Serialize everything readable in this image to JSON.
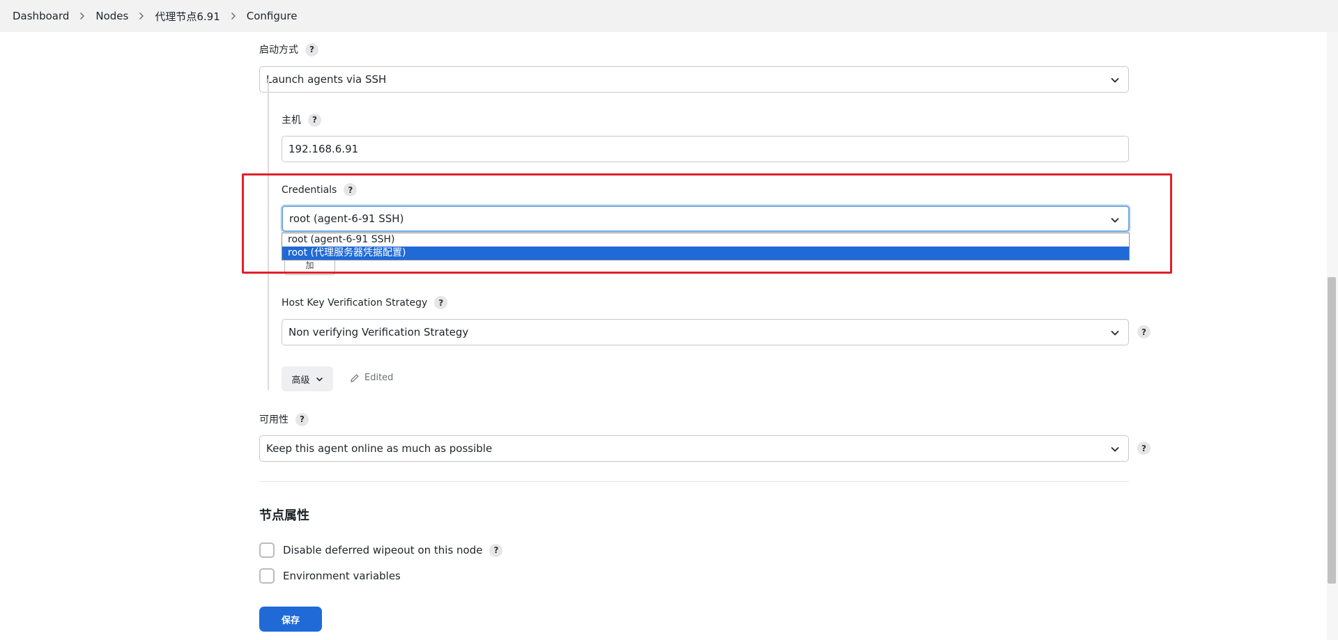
{
  "breadcrumb": {
    "items": [
      "Dashboard",
      "Nodes",
      "代理节点6.91",
      "Configure"
    ]
  },
  "launch_method": {
    "label": "启动方式",
    "help": "?",
    "value": "Launch agents via SSH"
  },
  "host": {
    "label": "主机",
    "help": "?",
    "value": "192.168.6.91"
  },
  "credentials": {
    "label": "Credentials",
    "help": "?",
    "value": "root (agent-6-91 SSH)",
    "options": [
      "root (agent-6-91 SSH)",
      "root (代理服务器凭据配置)"
    ],
    "highlighted_option_index": 1,
    "add_button_label": "加"
  },
  "host_key_strategy": {
    "label": "Host Key Verification Strategy",
    "help": "?",
    "value": "Non verifying Verification Strategy"
  },
  "advanced": {
    "label": "高级",
    "edited_label": "Edited"
  },
  "availability": {
    "label": "可用性",
    "help": "?",
    "value": "Keep this agent online as much as possible"
  },
  "node_properties": {
    "title": "节点属性",
    "checkboxes": [
      {
        "label": "Disable deferred wipeout on this node",
        "help": "?",
        "checked": false
      },
      {
        "label": "Environment variables",
        "checked": false
      }
    ]
  },
  "save_button_label": "保存",
  "colors": {
    "accent": "#1f6ad6",
    "highlight_box": "#e0202a",
    "selected_option_bg": "#1f6ad6"
  }
}
